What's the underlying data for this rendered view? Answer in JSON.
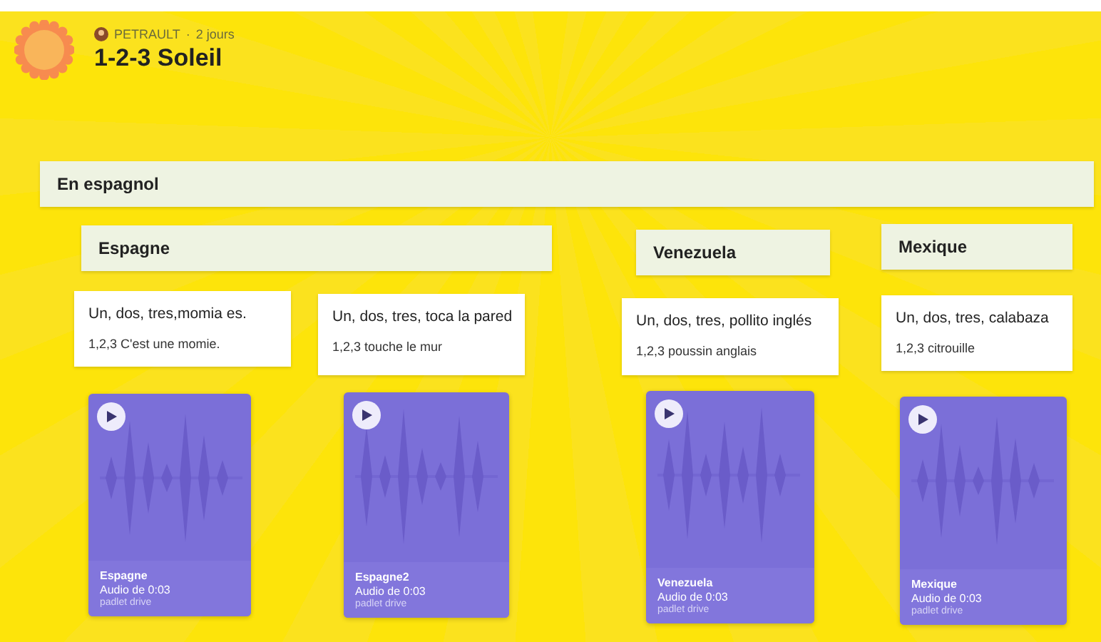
{
  "header": {
    "author": "PETRAULT",
    "separator": "·",
    "time": "2 jours",
    "title": "1-2-3 Soleil"
  },
  "section": {
    "label": "En espagnol"
  },
  "headings": [
    {
      "label": "Espagne"
    },
    {
      "label": "Venezuela"
    },
    {
      "label": "Mexique"
    }
  ],
  "notes": [
    {
      "title": "Un, dos, tres,momia es.",
      "body": "1,2,3 C'est une momie."
    },
    {
      "title": "Un, dos, tres, toca la pared",
      "body": "1,2,3 touche le mur"
    },
    {
      "title": "Un, dos, tres, pollito inglés",
      "body": "1,2,3 poussin anglais"
    },
    {
      "title": "Un, dos, tres, calabaza",
      "body": "1,2,3 citrouille"
    }
  ],
  "audios": [
    {
      "name": "Espagne",
      "detail": "Audio de 0:03",
      "source": "padlet drive"
    },
    {
      "name": "Espagne2",
      "detail": "Audio de 0:03",
      "source": "padlet drive"
    },
    {
      "name": "Venezuela",
      "detail": "Audio de 0:03",
      "source": "padlet drive"
    },
    {
      "name": "Mexique",
      "detail": "Audio de 0:03",
      "source": "padlet drive"
    }
  ]
}
